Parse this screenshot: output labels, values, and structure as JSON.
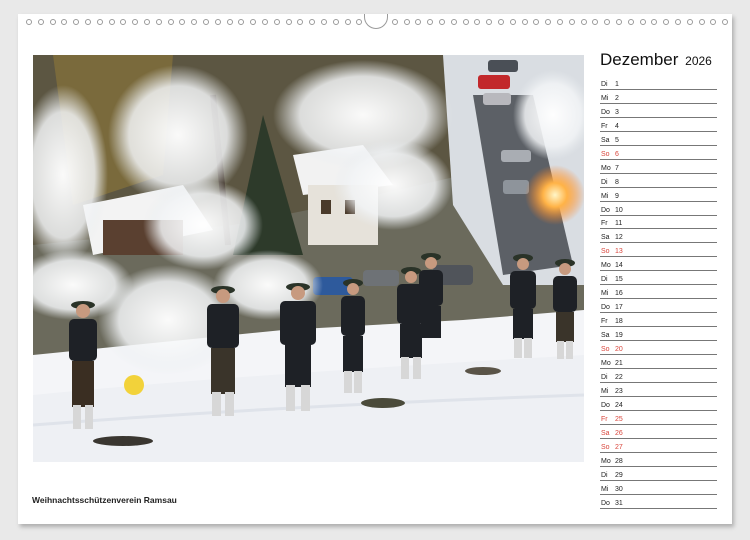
{
  "calendar": {
    "month": "Dezember",
    "year": "2026",
    "days": [
      {
        "wd": "Di",
        "d": "1",
        "red": false
      },
      {
        "wd": "Mi",
        "d": "2",
        "red": false
      },
      {
        "wd": "Do",
        "d": "3",
        "red": false
      },
      {
        "wd": "Fr",
        "d": "4",
        "red": false
      },
      {
        "wd": "Sa",
        "d": "5",
        "red": false
      },
      {
        "wd": "So",
        "d": "6",
        "red": true
      },
      {
        "wd": "Mo",
        "d": "7",
        "red": false
      },
      {
        "wd": "Di",
        "d": "8",
        "red": false
      },
      {
        "wd": "Mi",
        "d": "9",
        "red": false
      },
      {
        "wd": "Do",
        "d": "10",
        "red": false
      },
      {
        "wd": "Fr",
        "d": "11",
        "red": false
      },
      {
        "wd": "Sa",
        "d": "12",
        "red": false
      },
      {
        "wd": "So",
        "d": "13",
        "red": true
      },
      {
        "wd": "Mo",
        "d": "14",
        "red": false
      },
      {
        "wd": "Di",
        "d": "15",
        "red": false
      },
      {
        "wd": "Mi",
        "d": "16",
        "red": false
      },
      {
        "wd": "Do",
        "d": "17",
        "red": false
      },
      {
        "wd": "Fr",
        "d": "18",
        "red": false
      },
      {
        "wd": "Sa",
        "d": "19",
        "red": false
      },
      {
        "wd": "So",
        "d": "20",
        "red": true
      },
      {
        "wd": "Mo",
        "d": "21",
        "red": false
      },
      {
        "wd": "Di",
        "d": "22",
        "red": false
      },
      {
        "wd": "Mi",
        "d": "23",
        "red": false
      },
      {
        "wd": "Do",
        "d": "24",
        "red": false
      },
      {
        "wd": "Fr",
        "d": "25",
        "red": true
      },
      {
        "wd": "Sa",
        "d": "26",
        "red": true
      },
      {
        "wd": "So",
        "d": "27",
        "red": true
      },
      {
        "wd": "Mo",
        "d": "28",
        "red": false
      },
      {
        "wd": "Di",
        "d": "29",
        "red": false
      },
      {
        "wd": "Mi",
        "d": "30",
        "red": false
      },
      {
        "wd": "Do",
        "d": "31",
        "red": false
      }
    ]
  },
  "photo": {
    "caption": "Weihnachtsschützenverein Ramsau"
  },
  "colors": {
    "holiday": "#d9463c",
    "rule": "#777777"
  }
}
